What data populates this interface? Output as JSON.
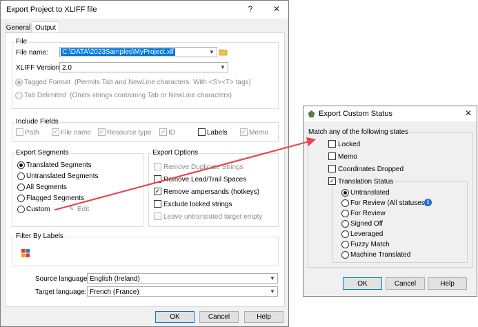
{
  "main_dialog": {
    "title": "Export Project to XLIFF file",
    "help_glyph": "?",
    "close_glyph": "✕",
    "tabs": [
      {
        "label": "General"
      },
      {
        "label": "Output"
      }
    ],
    "file_group": {
      "title": "File",
      "file_name_label": "File name:",
      "file_name_value": "C:\\DATA\\2023Samples\\MyProject.xlf",
      "xliff_version_label": "XLIFF Version:",
      "xliff_version_value": "2.0",
      "format_options": [
        {
          "label": "Tagged Format",
          "hint": "(Permits Tab and NewLine characters. With <S><T> tags)",
          "selected": true
        },
        {
          "label": "Tab Delimited",
          "hint": "(Omits strings containing Tab or NewLine characters)",
          "selected": false
        }
      ]
    },
    "include_fields": {
      "title": "Include Fields",
      "fields": [
        {
          "label": "Path",
          "checked": false,
          "enabled": false
        },
        {
          "label": "File name",
          "checked": true,
          "enabled": false
        },
        {
          "label": "Resource type",
          "checked": true,
          "enabled": false
        },
        {
          "label": "ID",
          "checked": true,
          "enabled": false
        },
        {
          "label": "Labels",
          "checked": false,
          "enabled": true
        },
        {
          "label": "Memo",
          "checked": true,
          "enabled": false
        }
      ]
    },
    "export_segments": {
      "title": "Export Segments",
      "options": [
        {
          "label": "Translated Segments",
          "selected": true
        },
        {
          "label": "Untranslated Segments",
          "selected": false
        },
        {
          "label": "All Segments",
          "selected": false
        },
        {
          "label": "Flagged Segments",
          "selected": false
        },
        {
          "label": "Custom",
          "selected": false
        }
      ],
      "edit_label": "Edit"
    },
    "export_options": {
      "title": "Export Options",
      "options": [
        {
          "label": "Remove Duplicate Strings",
          "checked": false,
          "enabled": false
        },
        {
          "label": "Remove Lead/Trail Spaces",
          "checked": false,
          "enabled": true
        },
        {
          "label": "Remove ampersands (hotkeys)",
          "checked": true,
          "enabled": true
        },
        {
          "label": "Exclude locked strings",
          "checked": false,
          "enabled": true
        },
        {
          "label": "Leave untranslated target empty",
          "checked": false,
          "enabled": false
        }
      ]
    },
    "filter_by_labels": {
      "title": "Filter By Labels"
    },
    "source_language_label": "Source language:",
    "source_language_value": "English (Ireland)",
    "target_language_label": "Target language:",
    "target_language_value": "French (France)",
    "buttons": {
      "ok": "OK",
      "cancel": "Cancel",
      "help": "Help"
    }
  },
  "custom_dialog": {
    "title": "Export Custom Status",
    "close_glyph": "✕",
    "group_title": "Match any of the following states",
    "checks": [
      {
        "label": "Locked",
        "checked": false
      },
      {
        "label": "Memo",
        "checked": false
      },
      {
        "label": "Coordinates Dropped",
        "checked": false
      }
    ],
    "translation_status": {
      "label": "Translation Status",
      "checked": true,
      "options": [
        {
          "label": "Untranslated",
          "selected": true
        },
        {
          "label": "For Review (All statuses)",
          "selected": false
        },
        {
          "label": "For Review",
          "selected": false
        },
        {
          "label": "Signed Off",
          "selected": false
        },
        {
          "label": "Leveraged",
          "selected": false
        },
        {
          "label": "Fuzzy Match",
          "selected": false
        },
        {
          "label": "Machine Translated",
          "selected": false
        }
      ]
    },
    "buttons": {
      "ok": "OK",
      "cancel": "Cancel",
      "help": "Help"
    }
  },
  "colors": {
    "arrow": "#e8454f",
    "accent": "#0078d7",
    "info": "#1e6fd9"
  }
}
